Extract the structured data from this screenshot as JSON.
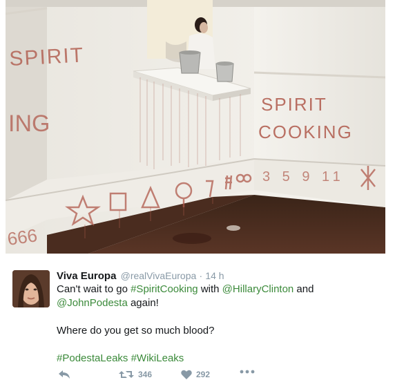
{
  "photo": {
    "wall_text_left": "SPIRIT",
    "wall_text_right_1": "SPIRIT",
    "wall_text_right_2": "COOKING",
    "wall_numbers": "3 5 9 11",
    "wall_666": "666"
  },
  "tweet": {
    "display_name": "Viva Europa",
    "handle": "@realVivaEuropa",
    "separator": "·",
    "time": "14 h",
    "line1_a": "Can't wait to go ",
    "line1_hashtag": "#SpiritCooking",
    "line1_b": " with ",
    "line1_mention": "@HillaryClinton",
    "line1_c": " and",
    "line2_mention": "@JohnPodesta",
    "line2_b": " again!",
    "line3": "Where do you get so much blood?",
    "hashtag_1": "#PodestaLeaks",
    "hashtag_2": "#WikiLeaks"
  },
  "actions": {
    "reply_icon": "reply-icon",
    "retweet_icon": "retweet-icon",
    "retweet_count": "346",
    "like_icon": "heart-icon",
    "like_count": "292",
    "more_icon": "more-icon"
  },
  "colors": {
    "link": "#3b8a3a",
    "muted": "#8899a6",
    "blood": "#b05a4c"
  }
}
